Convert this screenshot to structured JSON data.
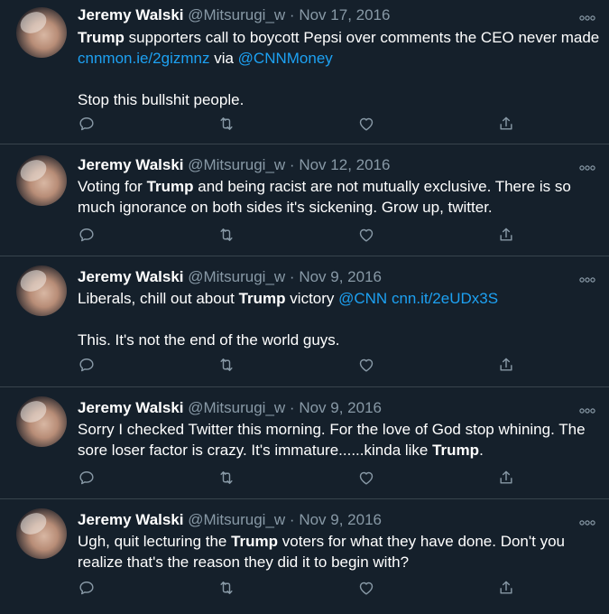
{
  "tweets": [
    {
      "name": "Jeremy Walski",
      "handle": "@Mitsurugi_w",
      "sep": "·",
      "date": "Nov 17, 2016",
      "b1": "Trump",
      "t1": " supporters call to boycott Pepsi over comments the CEO never made ",
      "l1": "cnnmon.ie/2gizmnz",
      "t2": " via ",
      "l2": "@CNNMoney",
      "p2": "Stop this bullshit people."
    },
    {
      "name": "Jeremy Walski",
      "handle": "@Mitsurugi_w",
      "sep": "·",
      "date": "Nov 12, 2016",
      "t1": "Voting for ",
      "b1": "Trump",
      "t2": " and being racist are not mutually exclusive.  There is so much ignorance on both sides it's sickening.  Grow up, twitter."
    },
    {
      "name": "Jeremy Walski",
      "handle": "@Mitsurugi_w",
      "sep": "·",
      "date": "Nov 9, 2016",
      "t1": "Liberals, chill out about ",
      "b1": "Trump",
      "t2": " victory ",
      "l1": "@CNN",
      "t3": " ",
      "l2": "cnn.it/2eUDx3S",
      "p2": "This.  It's not the end of the world guys."
    },
    {
      "name": "Jeremy Walski",
      "handle": "@Mitsurugi_w",
      "sep": "·",
      "date": "Nov 9, 2016",
      "t1": "Sorry I checked Twitter this morning. For the love of God stop whining. The sore loser factor is crazy. It's immature......kinda like ",
      "b1": "Trump",
      "t2": "."
    },
    {
      "name": "Jeremy Walski",
      "handle": "@Mitsurugi_w",
      "sep": "·",
      "date": "Nov 9, 2016",
      "t1": "Ugh, quit lecturing the ",
      "b1": "Trump",
      "t2": " voters for what they have done. Don't you realize that's the reason they did it to begin with?"
    }
  ],
  "icons": {
    "reply": "reply-icon",
    "retweet": "retweet-icon",
    "like": "like-icon",
    "share": "share-icon",
    "more": "more-icon"
  },
  "colors": {
    "background": "#15202b",
    "secondary_text": "#8899a6",
    "link": "#1da1f2",
    "divider": "#38444d"
  }
}
